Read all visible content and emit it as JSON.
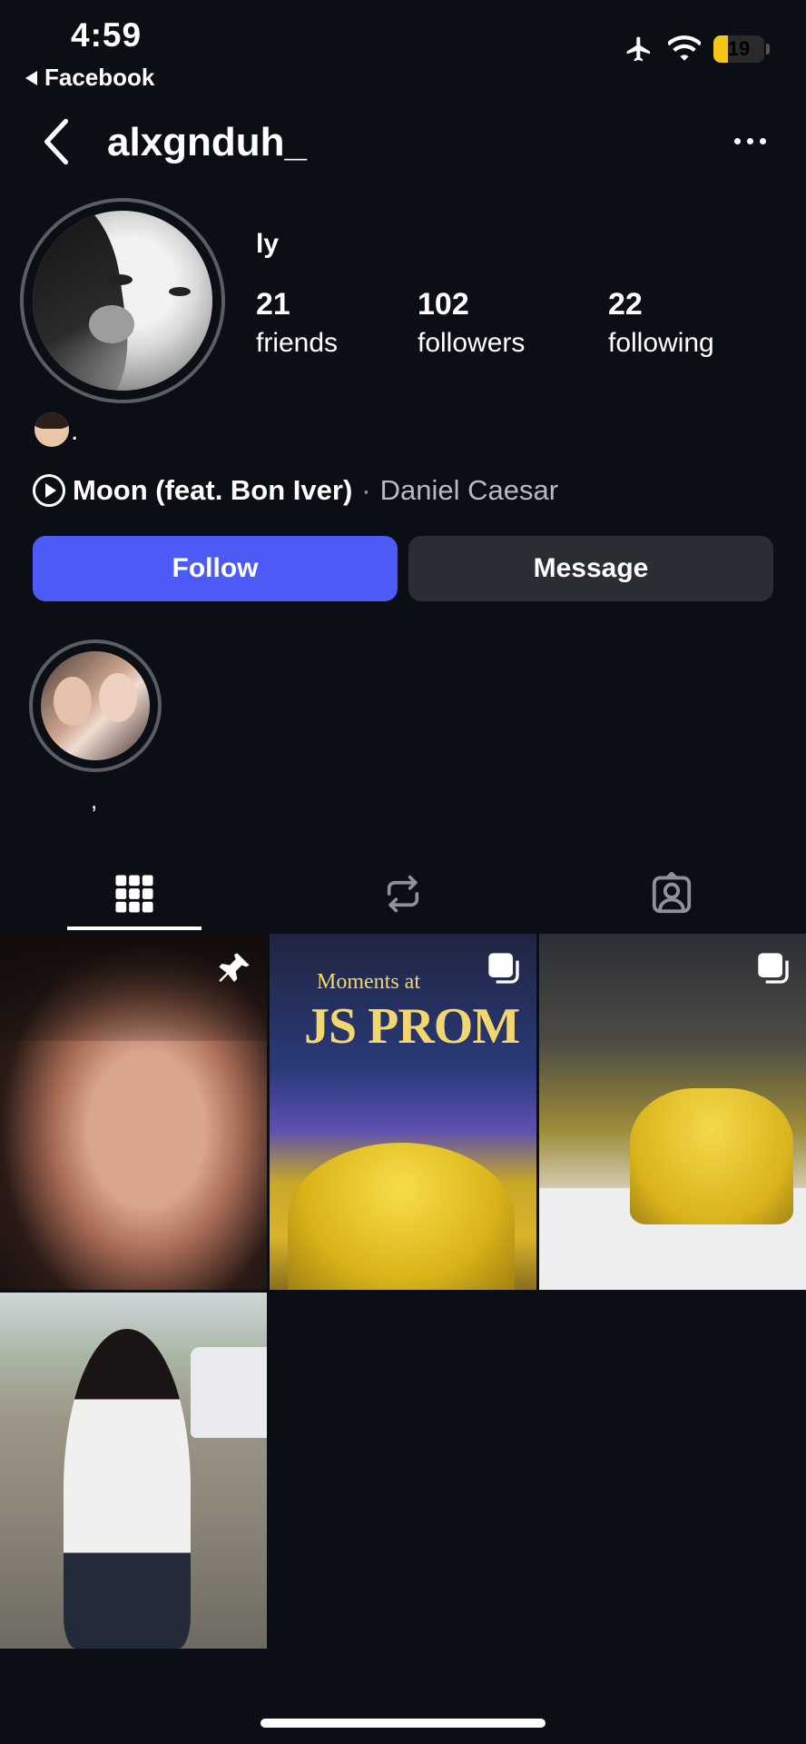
{
  "status_bar": {
    "time": "4:59",
    "back_app": "Facebook",
    "battery": "19"
  },
  "header": {
    "username": "alxgnduh_"
  },
  "profile": {
    "name": "ly",
    "stats": [
      {
        "num": "21",
        "label": "friends"
      },
      {
        "num": "102",
        "label": "followers"
      },
      {
        "num": "22",
        "label": "following"
      }
    ],
    "bio_suffix": ".",
    "music": {
      "song": "Moon (feat. Bon Iver)",
      "separator": "·",
      "artist": "Daniel Caesar"
    }
  },
  "actions": {
    "follow_label": "Follow",
    "message_label": "Message"
  },
  "highlights": [
    {
      "label": ","
    }
  ],
  "tabs": [
    {
      "icon": "grid-icon",
      "active": true
    },
    {
      "icon": "reposts-icon",
      "active": false
    },
    {
      "icon": "tagged-icon",
      "active": false
    }
  ],
  "posts": [
    {
      "kind": "photo",
      "badge": "pin-icon"
    },
    {
      "kind": "carousel",
      "badge": "carousel-icon",
      "text_small": "Moments at",
      "text_large": "JS PROM"
    },
    {
      "kind": "carousel",
      "badge": "carousel-icon"
    },
    {
      "kind": "photo"
    }
  ],
  "colors": {
    "background": "#0b0e14",
    "follow_button": "#4c5bf5",
    "message_button": "#2a2d33",
    "secondary_text": "#b8babf"
  }
}
